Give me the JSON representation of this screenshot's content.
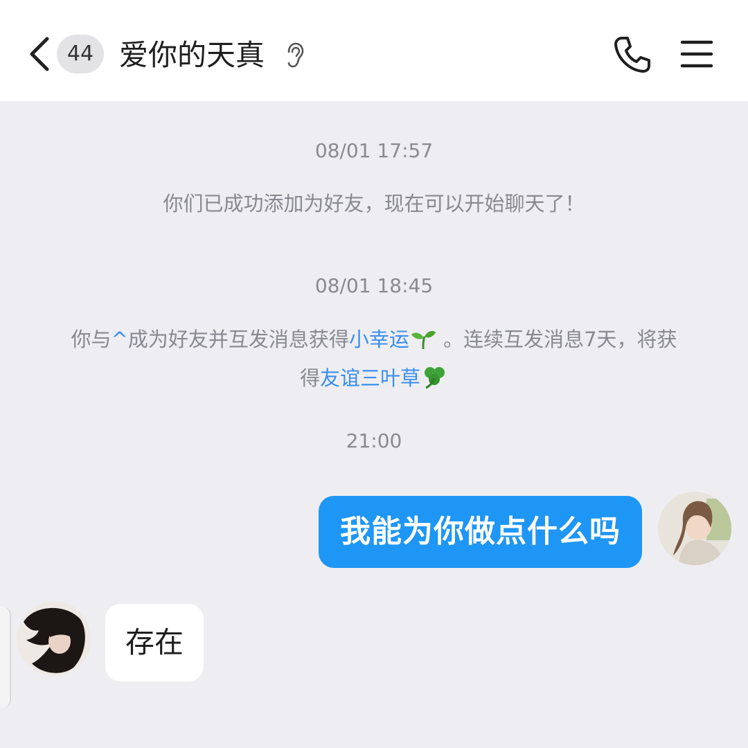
{
  "header": {
    "back_icon": "chevron-left-icon",
    "unread_count": "44",
    "title": "爱你的天真",
    "ear_icon": "ear-icon",
    "call_icon": "phone-icon",
    "menu_icon": "hamburger-menu-icon"
  },
  "messages": {
    "time_1": "08/01 17:57",
    "system_1": "你们已成功添加为好友，现在可以开始聊天了！",
    "time_2": "08/01 18:45",
    "system_2": {
      "part_a": "你与",
      "link_a": "^",
      "part_b": "成为好友并互发消息获得",
      "link_b": "小幸运",
      "part_c": "。连续互发消息7天，将获",
      "part_d": "得",
      "link_c": "友谊三叶草"
    },
    "time_3": "21:00",
    "outgoing_1": "我能为你做点什么吗",
    "incoming_1": "存在"
  },
  "colors": {
    "accent": "#1e96f5",
    "link": "#3a8ef0",
    "background": "#eeeef2"
  }
}
